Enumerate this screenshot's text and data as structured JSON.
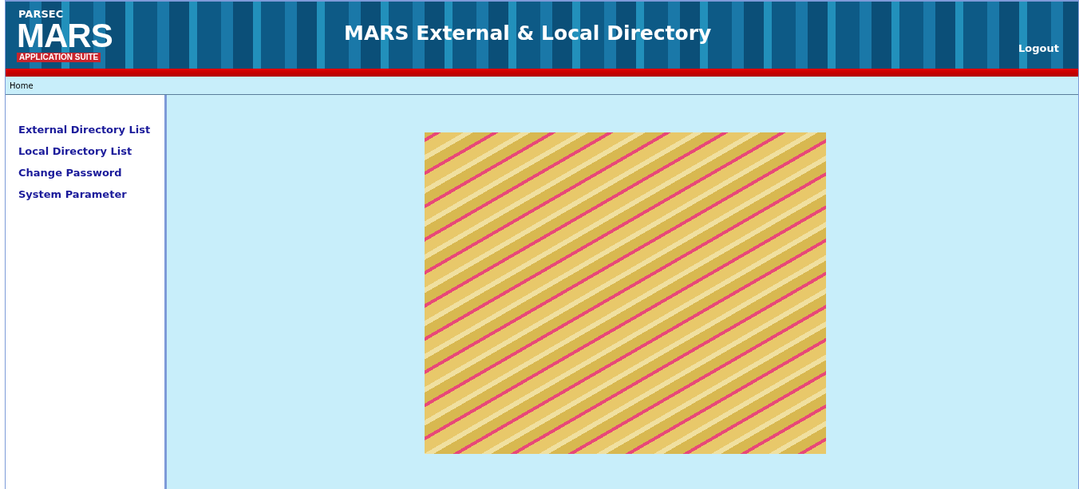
{
  "logo": {
    "top": "PARSEC",
    "main": "MARS",
    "tagline": "APPLICATION SUITE"
  },
  "header": {
    "title": "MARS External & Local Directory",
    "logout": "Logout"
  },
  "breadcrumb": "Home",
  "sidebar": {
    "items": [
      {
        "label": "External Directory List"
      },
      {
        "label": "Local Directory List"
      },
      {
        "label": "Change Password"
      },
      {
        "label": "System Parameter"
      }
    ]
  }
}
